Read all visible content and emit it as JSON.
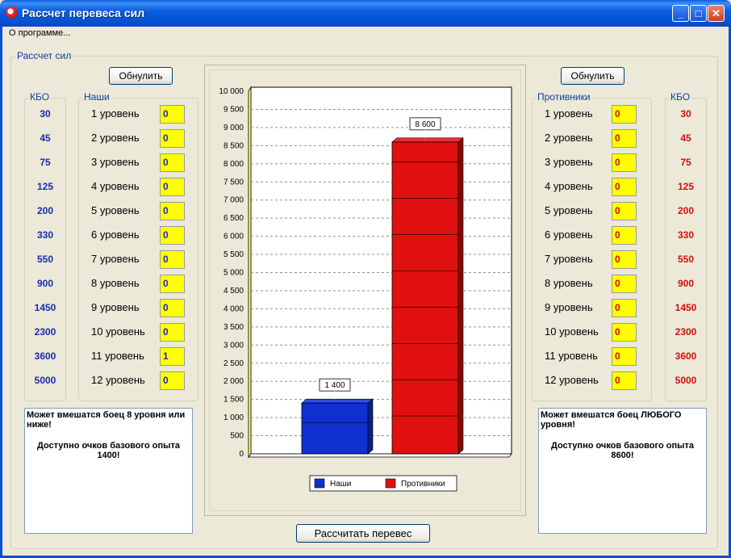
{
  "window": {
    "title": "Рассчет перевеса сил",
    "menu_about": "О программе...",
    "minimize": "_",
    "maximize": "□",
    "close": "✕"
  },
  "main_group": {
    "label": "Рассчет сил"
  },
  "left": {
    "reset_label": "Обнулить",
    "kbo_label": "КБО",
    "side_label": "Наши",
    "kbo": [
      "30",
      "45",
      "75",
      "125",
      "200",
      "330",
      "550",
      "900",
      "1450",
      "2300",
      "3600",
      "5000"
    ],
    "levels": [
      "1 уровень",
      "2 уровень",
      "3 уровень",
      "4 уровень",
      "5 уровень",
      "6 уровень",
      "7 уровень",
      "8 уровень",
      "9 уровень",
      "10 уровень",
      "11 уровень",
      "12 уровень"
    ],
    "counts": [
      "0",
      "0",
      "0",
      "0",
      "0",
      "0",
      "0",
      "0",
      "0",
      "0",
      "1",
      "0"
    ],
    "info_line1": "Может вмешатся боец 8 уровня или ниже!",
    "info_line2": "Доступно очков базового опыта 1400!"
  },
  "right": {
    "reset_label": "Обнулить",
    "kbo_label": "КБО",
    "side_label": "Противники",
    "kbo": [
      "30",
      "45",
      "75",
      "125",
      "200",
      "330",
      "550",
      "900",
      "1450",
      "2300",
      "3600",
      "5000"
    ],
    "levels": [
      "1 уровень",
      "2 уровень",
      "3 уровень",
      "4 уровень",
      "5 уровень",
      "6 уровень",
      "7 уровень",
      "8 уровень",
      "9 уровень",
      "10 уровень",
      "11 уровень",
      "12 уровень"
    ],
    "counts": [
      "0",
      "0",
      "0",
      "0",
      "0",
      "0",
      "0",
      "0",
      "0",
      "0",
      "0",
      "0"
    ],
    "info_line1": "Может вмешатся боец ЛЮБОГО уровня!",
    "info_line2": "Доступно очков базового опыта 8600!"
  },
  "calc_label": "Рассчитать перевес",
  "chart_data": {
    "type": "bar",
    "categories": [
      "Наши",
      "Противники"
    ],
    "values": [
      1400,
      8600
    ],
    "data_labels": [
      "1 400",
      "8 600"
    ],
    "colors": [
      "#1030d0",
      "#e01010"
    ],
    "ylim": [
      0,
      10000
    ],
    "y_ticks": [
      "0",
      "500",
      "1 000",
      "1 500",
      "2 000",
      "2 500",
      "3 000",
      "3 500",
      "4 000",
      "4 500",
      "5 000",
      "5 500",
      "6 000",
      "6 500",
      "7 000",
      "7 500",
      "8 000",
      "8 500",
      "9 000",
      "9 500",
      "10 000"
    ],
    "grid": true,
    "legend": "bottom",
    "title": "",
    "xlabel": "",
    "ylabel": ""
  }
}
